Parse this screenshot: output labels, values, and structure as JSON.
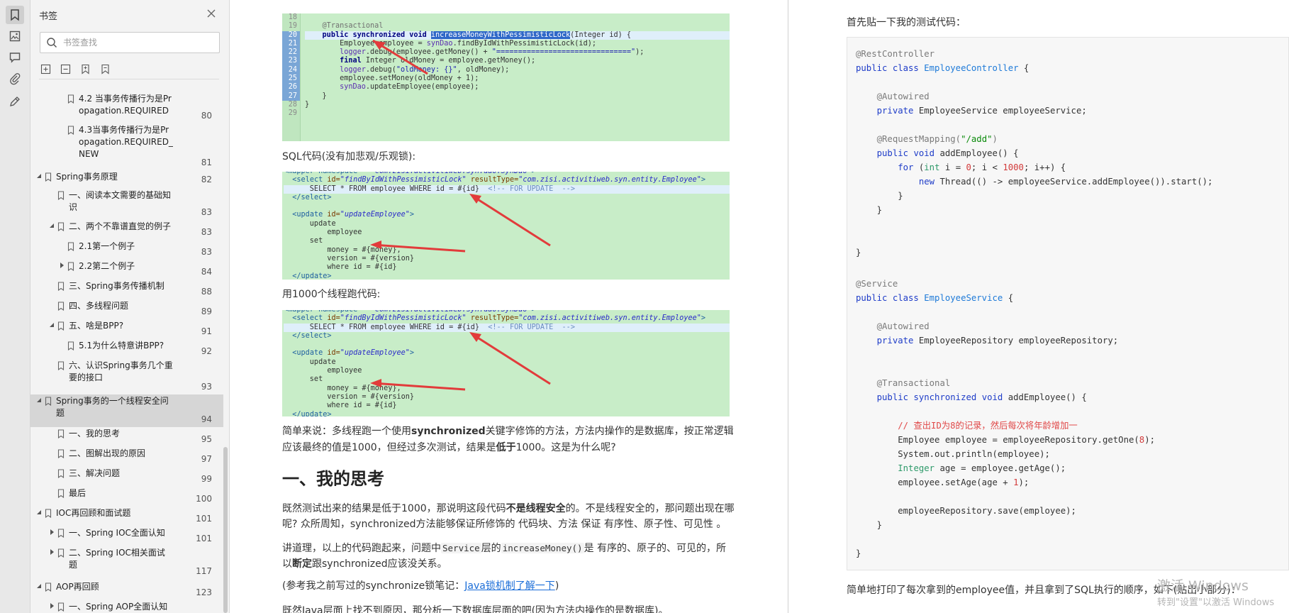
{
  "bookmarks": {
    "title": "书签",
    "search_placeholder": "书签查找",
    "items": [
      {
        "label": "4.2 当事务传播行为是Pr\nopagation.REQUIRED",
        "page": "80"
      },
      {
        "label": "4.3当事务传播行为是Pr\nopagation.REQUIRED_\nNEW",
        "page": "81"
      },
      {
        "label": "Spring事务原理",
        "page": "82"
      },
      {
        "label": "一、阅读本文需要的基础知\n识",
        "page": "83"
      },
      {
        "label": "二、两个不靠谱直觉的例子",
        "page": "83"
      },
      {
        "label": "2.1第一个例子",
        "page": "83"
      },
      {
        "label": "2.2第二个例子",
        "page": "84"
      },
      {
        "label": "三、Spring事务传播机制",
        "page": "88"
      },
      {
        "label": "四、多线程问题",
        "page": "89"
      },
      {
        "label": "五、啥是BPP?",
        "page": "91"
      },
      {
        "label": "5.1为什么特意讲BPP?",
        "page": "92"
      },
      {
        "label": "六、认识Spring事务几个重\n要的接口",
        "page": "93"
      },
      {
        "label": "Spring事务的一个线程安全问\n题",
        "page": "94"
      },
      {
        "label": "一、我的思考",
        "page": "95"
      },
      {
        "label": "二、图解出现的原因",
        "page": "97"
      },
      {
        "label": "三、解决问题",
        "page": "99"
      },
      {
        "label": "最后",
        "page": "100"
      },
      {
        "label": "IOC再回顾和面试题",
        "page": "101"
      },
      {
        "label": "一、Spring IOC全面认知",
        "page": "101"
      },
      {
        "label": "二、Spring IOC相关面试\n题",
        "page": "117"
      },
      {
        "label": "AOP再回顾",
        "page": "123"
      },
      {
        "label": "一、Spring AOP全面认知",
        "page": ""
      }
    ]
  },
  "left_page": {
    "shot1": {
      "line_numbers": [
        "18",
        "19",
        "20",
        "21",
        "22",
        "23",
        "24",
        "25",
        "26",
        "27",
        "28",
        "29"
      ]
    },
    "sql_caption": "SQL代码(没有加悲观/乐观锁):",
    "threads_caption": "用1000个线程跑代码:",
    "para1_a": "简单来说：多线程跑一个使用",
    "para1_b": "synchronized",
    "para1_c": "关键字修饰的方法，方法内操作的是数据库，按正常逻辑",
    "para1_line2_a": "应该最终的值是1000，但经过多次测试，结果是",
    "para1_line2_b": "低于",
    "para1_line2_c": "1000。这是为什么呢?",
    "heading": "一、我的思考",
    "para2_a": "既然测试出来的结果是低于1000，那说明这段代码",
    "para2_b": "不是线程安全",
    "para2_c": "的。不是线程安全的，那问题出现在哪",
    "para2_line2": "呢? 众所周知，synchronized方法能够保证所修饰的 代码块、方法 保证 有序性、原子性、可见性 。",
    "para3_a": "讲道理，以上的代码跑起来，问题中",
    "para3_code1": "Service",
    "para3_b": "层的",
    "para3_code2": "increaseMoney()",
    "para3_c": "是 有序的、原子的、可见的，所",
    "para3_line2_a": "以",
    "para3_line2_b": "断定",
    "para3_line2_c": "跟synchronized应该没关系。",
    "para4_a": "(参考我之前写过的synchronize锁笔记：",
    "para4_link": "Java锁机制了解一下",
    "para4_c": ")",
    "para5": "既然Java层面上找不到原因，那分析一下数据库层面的吧(因为方法内操作的是数据库)。"
  },
  "right_page": {
    "intro": "首先贴一下我的测试代码：",
    "outro": "简单地打印了每次拿到的employee值，并且拿到了SQL执行的顺序，如下(贴出小部分)："
  },
  "watermark": {
    "line1": "激活 Windows",
    "line2": "转到\"设置\"以激活 Windows"
  },
  "colors": {
    "code_bg": "#c8edc8",
    "link": "#1a6dd8",
    "arrow": "#e23b3b",
    "selection": "#2f68c8"
  }
}
